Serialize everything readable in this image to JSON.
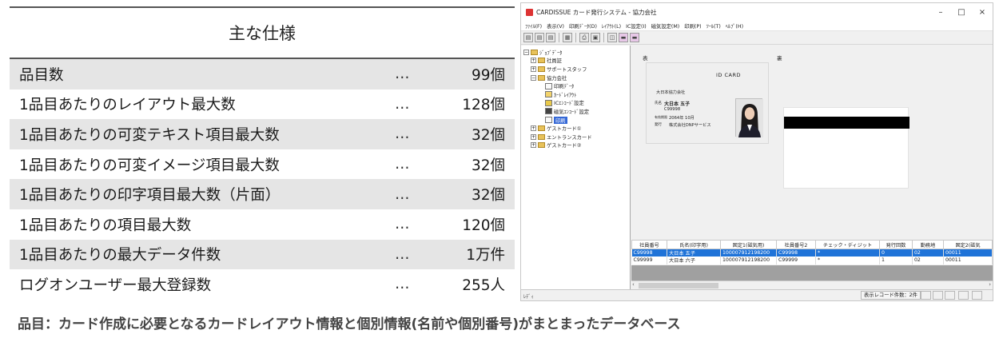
{
  "spec": {
    "title": "主な仕様",
    "rows": [
      {
        "label": "品目数",
        "sep": "…",
        "value": "99個"
      },
      {
        "label": "1品目あたりのレイアウト最大数",
        "sep": "…",
        "value": "128個"
      },
      {
        "label": "1品目あたりの可変テキスト項目最大数",
        "sep": "…",
        "value": "32個"
      },
      {
        "label": "1品目あたりの可変イメージ項目最大数",
        "sep": "…",
        "value": "32個"
      },
      {
        "label": "1品目あたりの印字項目最大数（片面）",
        "sep": "…",
        "value": "32個"
      },
      {
        "label": "1品目あたりの項目最大数",
        "sep": "…",
        "value": "120個"
      },
      {
        "label": "1品目あたりの最大データ件数",
        "sep": "…",
        "value": "1万件"
      },
      {
        "label": "ログオンユーザー最大登録数",
        "sep": "…",
        "value": "255人"
      }
    ],
    "caption": "品目：カード作成に必要となるカードレイアウト情報と個別情報(名前や個別番号)がまとまったデータベース"
  },
  "window": {
    "title": "CARDISSUE カード発行システム - 協力会社",
    "controls": {
      "minimize": "–",
      "maximize": "□",
      "close": "×"
    },
    "menu": [
      "ﾌｧｲﾙ(F)",
      "表示(V)",
      "印刷ﾃﾞｰﾀ(D)",
      "ﾚｲｱｳﾄ(L)",
      "IC設定(I)",
      "磁気設定(M)",
      "印刷(P)",
      "ﾂｰﾙ(T)",
      "ﾍﾙﾌﾟ(H)"
    ],
    "tree": {
      "root": "ｼﾞｮﾌﾞﾃﾞｰﾀ",
      "items": [
        "社員証",
        "サポートスタッフ",
        "協力会社"
      ],
      "children": [
        "印刷ﾃﾞｰﾀ",
        "ｶｰﾄﾞﾚｲｱｳﾄ",
        "ICｴﾝｺｰﾄﾞ設定",
        "磁気ｴﾝｺｰﾄﾞ設定",
        "印刷"
      ],
      "after": [
        "ゲストカード①",
        "エントランスカード",
        "ゲストカード②"
      ]
    },
    "preview": {
      "front_label": "表",
      "back_label": "裏",
      "card_title": "ID CARD",
      "company_line": "大日本協力会社",
      "name_key": "氏名",
      "name": "大日本 五子",
      "number": "C99998",
      "date_key": "有効期限",
      "date": "2064年 10月",
      "issuer_key": "発行",
      "issuer": "株式会社DNPサービス"
    },
    "grid": {
      "headers": [
        "社員番号",
        "氏名(印字用)",
        "固定1(磁気用)",
        "社員番号2",
        "チェック・ディジット",
        "発行回数",
        "勤務地",
        "固定2(磁気"
      ],
      "rows": [
        [
          "C99998",
          "大日本 五子",
          "100007912198200",
          "C99998",
          "*",
          "0",
          "02",
          "00011"
        ],
        [
          "C99999",
          "大日本 六子",
          "100007912198200",
          "C99999",
          "*",
          "1",
          "02",
          "00011"
        ]
      ],
      "selected_row": 0
    },
    "status": {
      "left": "ﾚﾃﾞｨ",
      "record_count": "表示レコード件数：2件"
    }
  }
}
